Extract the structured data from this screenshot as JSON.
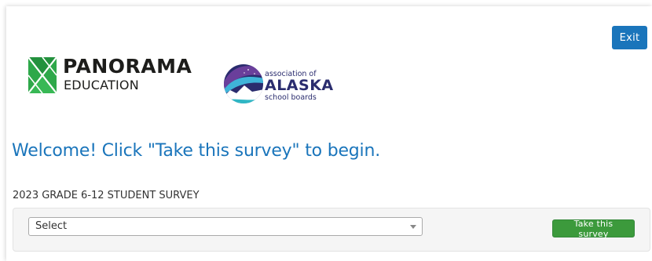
{
  "header": {
    "exit_label": "Exit",
    "accent_color": "#1a75bb"
  },
  "logos": {
    "panorama": {
      "name": "PANORAMA",
      "sub": "EDUCATION",
      "mark_color": "#2ea84a"
    },
    "aasb": {
      "line1": "association of",
      "line2": "ALASKA",
      "line3": "school boards"
    }
  },
  "main": {
    "welcome": "Welcome! Click \"Take this survey\" to begin.",
    "survey_name": "2023 GRADE 6-12 STUDENT SURVEY"
  },
  "form": {
    "select_value": "Select",
    "take_label": "Take this survey",
    "take_color": "#3c9a3c"
  }
}
